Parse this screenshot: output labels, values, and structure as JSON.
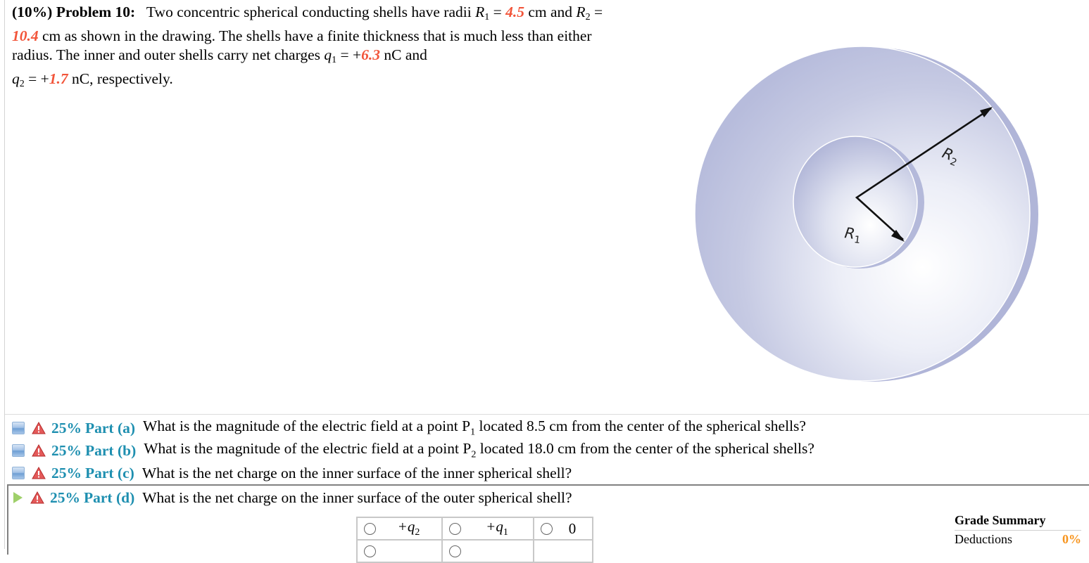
{
  "problem": {
    "header": "(10%)  Problem 10:",
    "seg1": "Two concentric spherical conducting shells have radii ",
    "r1_var": "R",
    "r1_sub": "1",
    "r1_value": "4.5",
    "unit_cm": "cm",
    "seg2": "and ",
    "r2_var": "R",
    "r2_sub": "2",
    "r2_value": "10.4",
    "seg3": " cm as shown in the drawing. The shells have a finite thickness that is much less than either radius. The inner and outer shells carry net charges ",
    "q1_var": "q",
    "q1_sub": "1",
    "q1_value": "6.3",
    "unit_nc": "nC",
    "seg4": " and",
    "q2_var": "q",
    "q2_sub": "2",
    "q2_value": "1.7",
    "seg5": " nC, respectively.",
    "eq": " = ",
    "plus": "+"
  },
  "diagram": {
    "label_r1": "R",
    "label_r1_sub": "1",
    "label_r2": "R",
    "label_r2_sub": "2",
    "shell_color": "#b9bedd"
  },
  "parts": [
    {
      "percent": "25%",
      "label": "Part (a)",
      "text_before": "What is the magnitude of the electric field at a point P",
      "sub": "1",
      "text_after": " located 8.5 cm from the center of the spherical shells?",
      "state": "collapsed"
    },
    {
      "percent": "25%",
      "label": "Part (b)",
      "text_before": "What is the magnitude of the electric field at a point P",
      "sub": "2",
      "text_after": " located 18.0 cm from the center of the spherical shells?",
      "state": "collapsed"
    },
    {
      "percent": "25%",
      "label": "Part (c)",
      "text_before": "What is the net charge on the inner surface of the inner spherical shell?",
      "sub": "",
      "text_after": "",
      "state": "collapsed"
    },
    {
      "percent": "25%",
      "label": "Part (d)",
      "text_before": "What is the net charge on the inner surface of the outer spherical shell?",
      "sub": "",
      "text_after": "",
      "state": "active"
    }
  ],
  "choices": [
    {
      "sign": "+",
      "var": "q",
      "sub": "2"
    },
    {
      "sign": "+",
      "var": "q",
      "sub": "1"
    },
    {
      "sign": "",
      "var": "0",
      "sub": ""
    }
  ],
  "grade_summary": {
    "title": "Grade Summary",
    "rows": [
      {
        "label": "Deductions",
        "value": "0%"
      }
    ]
  },
  "colors": {
    "given_value": "#f2553a",
    "part_label": "#1e8fb0",
    "grade_value": "#f7941d"
  }
}
